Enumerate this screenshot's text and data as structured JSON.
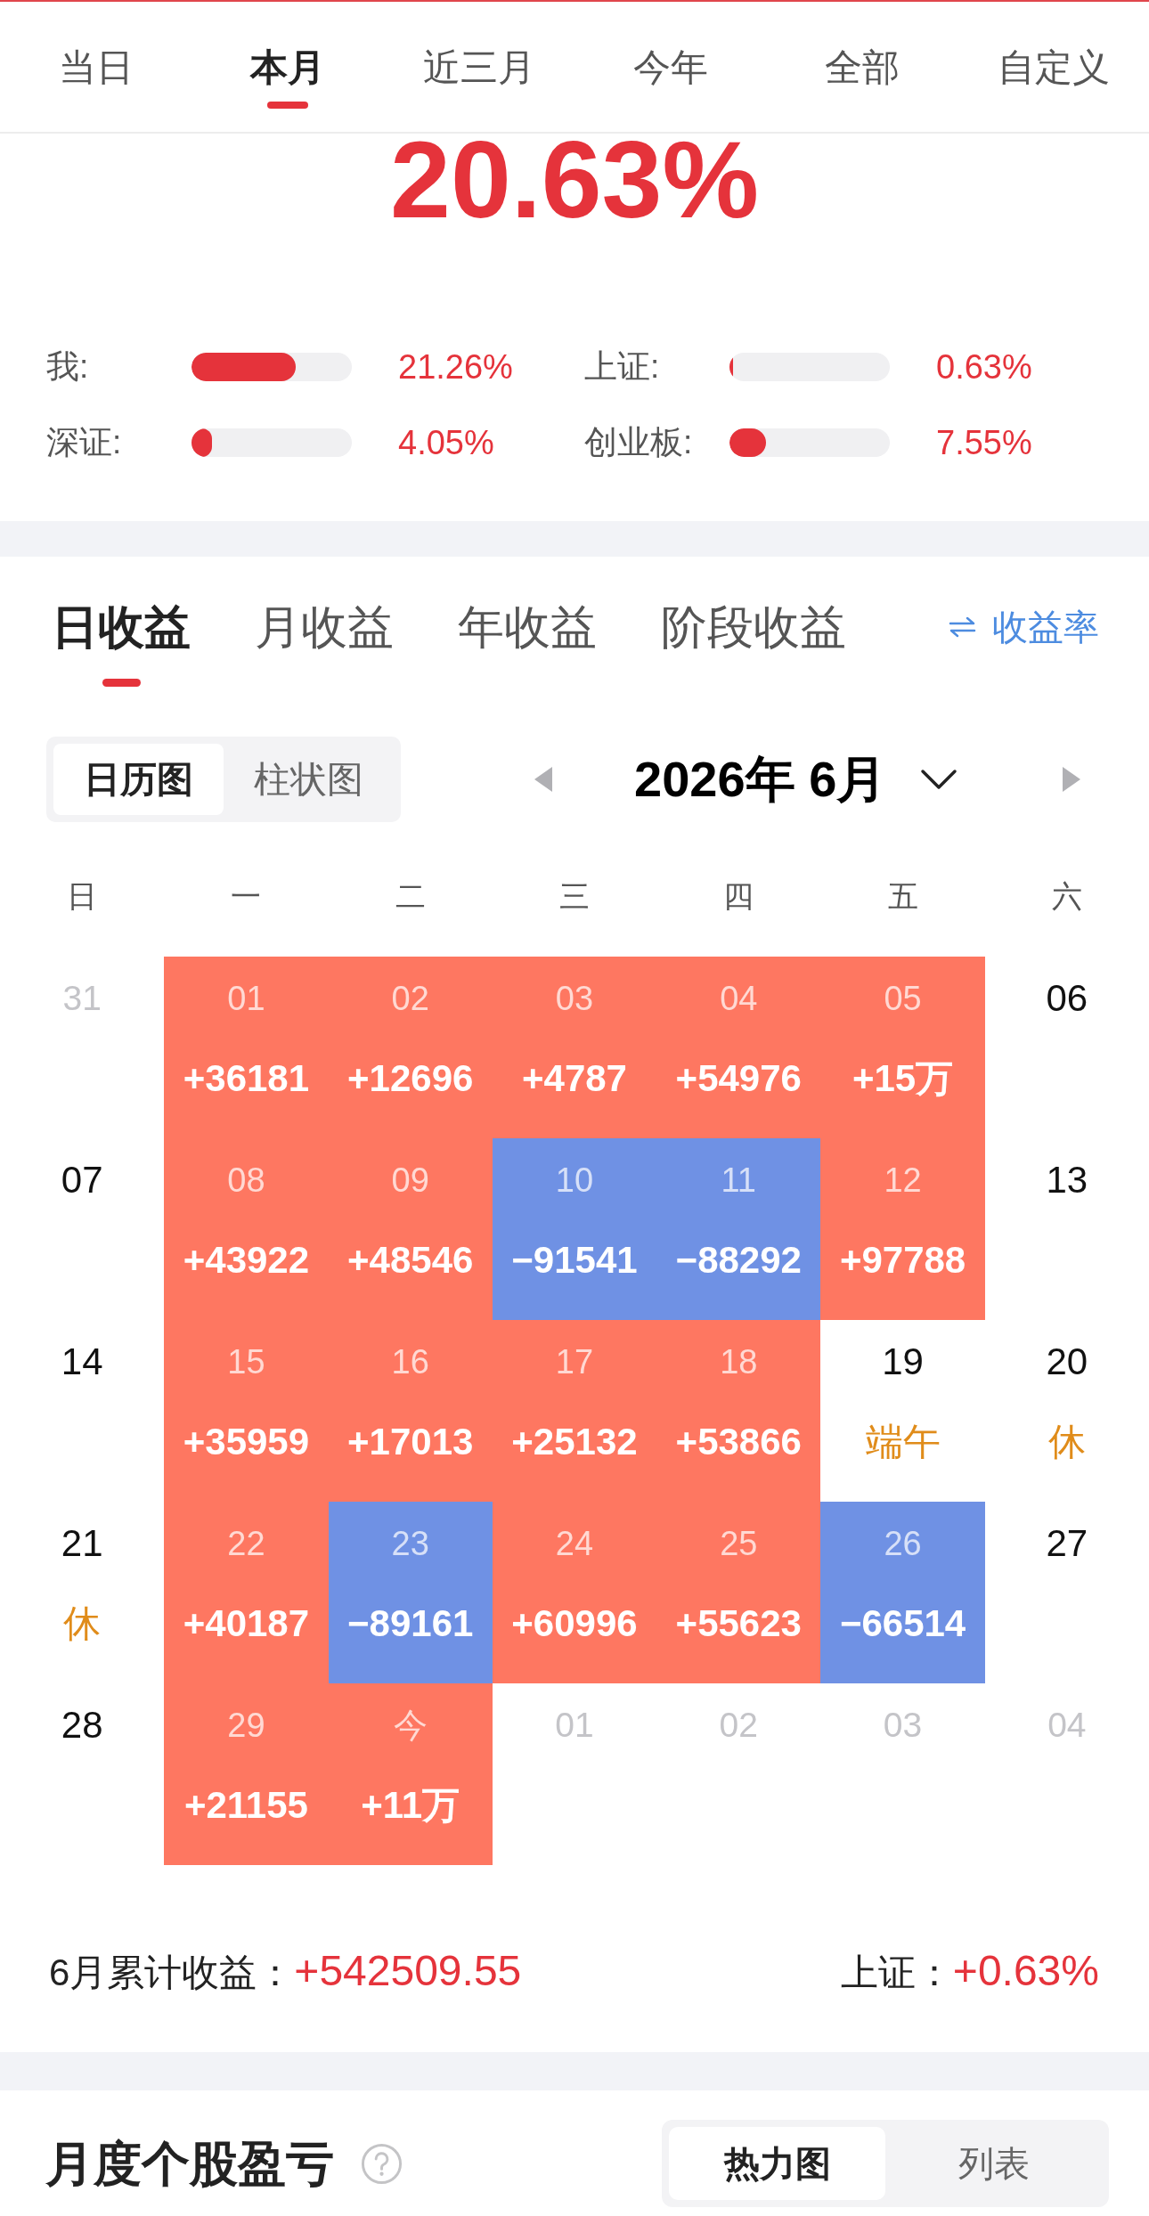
{
  "period_tabs": [
    {
      "label": "当日",
      "selected": false
    },
    {
      "label": "本月",
      "selected": true
    },
    {
      "label": "近三月",
      "selected": false
    },
    {
      "label": "今年",
      "selected": false
    },
    {
      "label": "全部",
      "selected": false
    },
    {
      "label": "自定义",
      "selected": false
    }
  ],
  "summary": {
    "return_rate": "20.63%",
    "comparisons": [
      {
        "label": "我:",
        "level": 0.65,
        "value": "21.26%"
      },
      {
        "label": "上证:",
        "level": 0.02,
        "value": "0.63%"
      },
      {
        "label": "深证:",
        "level": 0.13,
        "value": "4.05%"
      },
      {
        "label": "创业板:",
        "level": 0.23,
        "value": "7.55%"
      }
    ]
  },
  "profit_tabs": [
    {
      "label": "日收益",
      "selected": true
    },
    {
      "label": "月收益",
      "selected": false
    },
    {
      "label": "年收益",
      "selected": false
    },
    {
      "label": "阶段收益",
      "selected": false
    }
  ],
  "rate_toggle": {
    "label": "收益率"
  },
  "chart_view": [
    {
      "label": "日历图",
      "selected": true
    },
    {
      "label": "柱状图",
      "selected": false
    }
  ],
  "month_nav": {
    "title": "2026年 6月"
  },
  "calendar": {
    "weekdays": [
      "日",
      "一",
      "二",
      "三",
      "四",
      "五",
      "六"
    ],
    "days": [
      {
        "kind": "other",
        "day": "31"
      },
      {
        "kind": "trade",
        "day": "01",
        "value": "+36181",
        "color": "#fe7761"
      },
      {
        "kind": "trade",
        "day": "02",
        "value": "+12696",
        "color": "#fe7761"
      },
      {
        "kind": "trade",
        "day": "03",
        "value": "+4787",
        "color": "#fe7761"
      },
      {
        "kind": "trade",
        "day": "04",
        "value": "+54976",
        "color": "#fe7761"
      },
      {
        "kind": "trade",
        "day": "05",
        "value": "+15万",
        "color": "#fe7761"
      },
      {
        "kind": "rest",
        "day": "06"
      },
      {
        "kind": "rest",
        "day": "07"
      },
      {
        "kind": "trade",
        "day": "08",
        "value": "+43922",
        "color": "#fe7761"
      },
      {
        "kind": "trade",
        "day": "09",
        "value": "+48546",
        "color": "#fe7761"
      },
      {
        "kind": "trade",
        "day": "10",
        "value": "−91541",
        "color": "#6f91e4"
      },
      {
        "kind": "trade",
        "day": "11",
        "value": "−88292",
        "color": "#6f91e4"
      },
      {
        "kind": "trade",
        "day": "12",
        "value": "+97788",
        "color": "#fe7761"
      },
      {
        "kind": "rest",
        "day": "13"
      },
      {
        "kind": "rest",
        "day": "14"
      },
      {
        "kind": "trade",
        "day": "15",
        "value": "+35959",
        "color": "#fe7761"
      },
      {
        "kind": "trade",
        "day": "16",
        "value": "+17013",
        "color": "#fe7761"
      },
      {
        "kind": "trade",
        "day": "17",
        "value": "+25132",
        "color": "#fe7761"
      },
      {
        "kind": "trade",
        "day": "18",
        "value": "+53866",
        "color": "#fe7761"
      },
      {
        "kind": "rest",
        "day": "19",
        "note": "端午"
      },
      {
        "kind": "rest",
        "day": "20",
        "note": "休"
      },
      {
        "kind": "rest",
        "day": "21",
        "note": "休"
      },
      {
        "kind": "trade",
        "day": "22",
        "value": "+40187",
        "color": "#fe7761"
      },
      {
        "kind": "trade",
        "day": "23",
        "value": "−89161",
        "color": "#6f91e4"
      },
      {
        "kind": "trade",
        "day": "24",
        "value": "+60996",
        "color": "#fe7761"
      },
      {
        "kind": "trade",
        "day": "25",
        "value": "+55623",
        "color": "#fe7761"
      },
      {
        "kind": "trade",
        "day": "26",
        "value": "−66514",
        "color": "#6f91e4"
      },
      {
        "kind": "rest",
        "day": "27"
      },
      {
        "kind": "rest",
        "day": "28"
      },
      {
        "kind": "trade",
        "day": "29",
        "value": "+21155",
        "color": "#fe7761"
      },
      {
        "kind": "trade",
        "day": "今",
        "value": "+11万",
        "color": "#fe7761"
      },
      {
        "kind": "other",
        "day": "01"
      },
      {
        "kind": "other",
        "day": "02"
      },
      {
        "kind": "other",
        "day": "03"
      },
      {
        "kind": "other",
        "day": "04"
      }
    ]
  },
  "month_total": {
    "label": "6月累计收益：",
    "value": "+542509.55",
    "index_label": "上证：",
    "index_value": "+0.63%"
  },
  "stock_section": {
    "title": "月度个股盈亏",
    "views": [
      {
        "label": "热力图",
        "selected": true
      },
      {
        "label": "列表",
        "selected": false
      }
    ]
  }
}
